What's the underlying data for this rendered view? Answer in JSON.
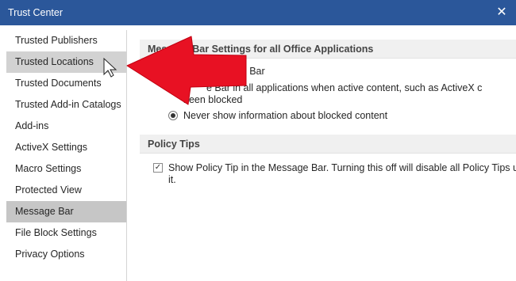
{
  "window": {
    "title": "Trust Center",
    "close_icon": "close-icon"
  },
  "sidebar": {
    "items": [
      {
        "label": "Trusted Publishers"
      },
      {
        "label": "Trusted Locations"
      },
      {
        "label": "Trusted Documents"
      },
      {
        "label": "Trusted Add-in Catalogs"
      },
      {
        "label": "Add-ins"
      },
      {
        "label": "ActiveX Settings"
      },
      {
        "label": "Macro Settings"
      },
      {
        "label": "Protected View"
      },
      {
        "label": "Message Bar"
      },
      {
        "label": "File Block Settings"
      },
      {
        "label": "Privacy Options"
      }
    ],
    "selected": "Message Bar",
    "hovered": "Trusted Locations"
  },
  "message_bar_section": {
    "header": "Message Bar Settings for all Office Applications",
    "option1_text": "Message Bar",
    "option2_line1": "e Bar in all applications when active content, such as ActiveX c",
    "option2_line2": "been blocked",
    "option3_text": "Never show information about blocked content",
    "selected_option": "option3"
  },
  "policy_tips_section": {
    "header": "Policy Tips",
    "checkbox_line1": "Show Policy Tip in the Message Bar. Turning this off will disable all Policy Tips unle",
    "checkbox_line2": "it.",
    "checked": true
  },
  "annotation": {
    "color": "#e81123"
  },
  "colors": {
    "titlebar": "#2b579a",
    "selected_item": "#c6c6c6",
    "section_header": "#f0f0f0"
  }
}
